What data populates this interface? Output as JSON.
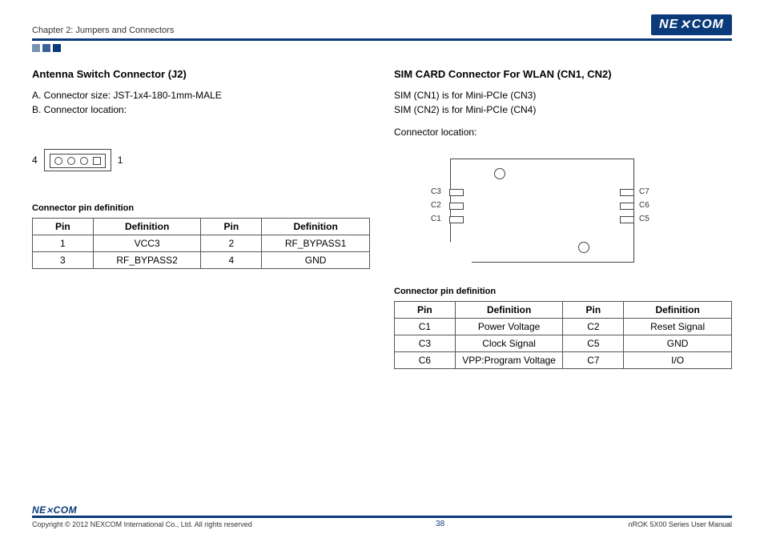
{
  "header": {
    "chapter": "Chapter 2: Jumpers and Connectors",
    "logo_left": "NE",
    "logo_right": "COM"
  },
  "left": {
    "title": "Antenna Switch Connector (J2)",
    "lineA": "A. Connector size: JST-1x4-180-1mm-MALE",
    "lineB": "B. Connector location:",
    "pin_left": "4",
    "pin_right": "1",
    "table_title": "Connector pin definition",
    "head_pin": "Pin",
    "head_def": "Definition",
    "rows": [
      {
        "p1": "1",
        "d1": "VCC3",
        "p2": "2",
        "d2": "RF_BYPASS1"
      },
      {
        "p1": "3",
        "d1": "RF_BYPASS2",
        "p2": "4",
        "d2": "GND"
      }
    ]
  },
  "right": {
    "title": "SIM CARD Connector For WLAN (CN1, CN2)",
    "line1": "SIM (CN1) is for Mini-PCIe (CN3)",
    "line2": "SIM (CN2) is for Mini-PCIe (CN4)",
    "line3": "Connector location:",
    "labels": {
      "c1": "C1",
      "c2": "C2",
      "c3": "C3",
      "c5": "C5",
      "c6": "C6",
      "c7": "C7"
    },
    "table_title": "Connector pin definition",
    "head_pin": "Pin",
    "head_def": "Definition",
    "rows": [
      {
        "p1": "C1",
        "d1": "Power Voltage",
        "p2": "C2",
        "d2": "Reset Signal"
      },
      {
        "p1": "C3",
        "d1": "Clock Signal",
        "p2": "C5",
        "d2": "GND"
      },
      {
        "p1": "C6",
        "d1": "VPP:Program Voltage",
        "p2": "C7",
        "d2": "I/O"
      }
    ]
  },
  "footer": {
    "logo_left": "NE",
    "logo_right": "COM",
    "copyright": "Copyright © 2012 NEXCOM International Co., Ltd. All rights reserved",
    "page": "38",
    "manual": "nROK 5X00 Series User Manual"
  }
}
